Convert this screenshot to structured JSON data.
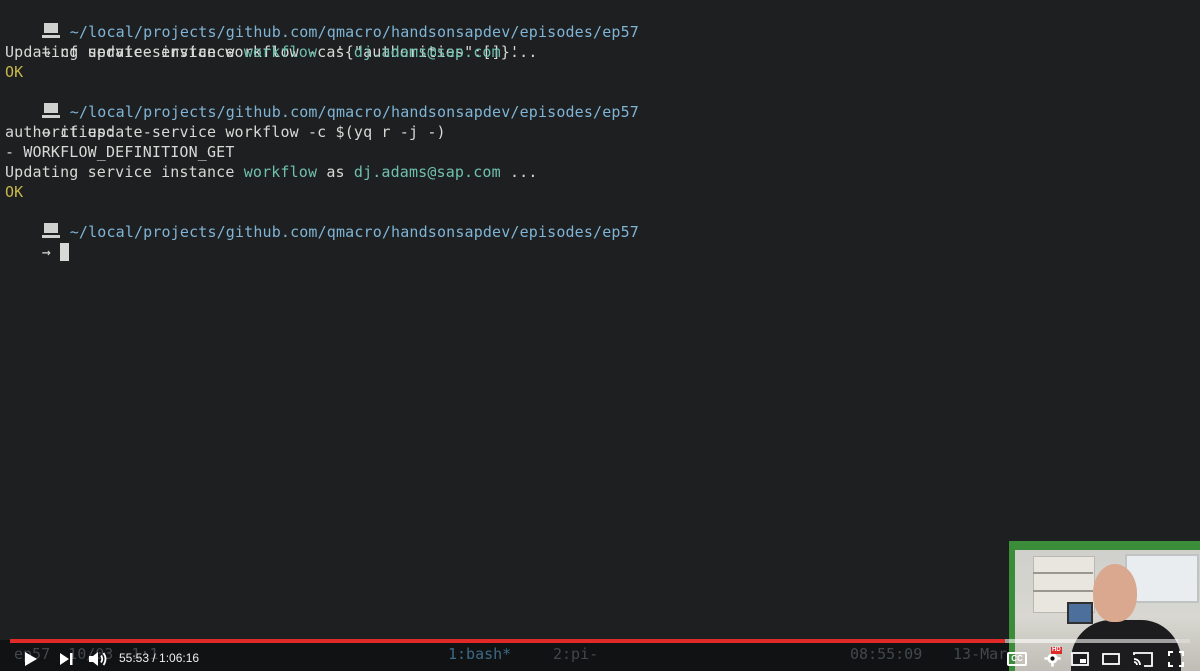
{
  "terminal": {
    "line1": {
      "path": "~/local/projects/github.com/qmacro/handsonsapdev/episodes/ep57"
    },
    "line2": {
      "arrow": "→",
      "command": "cf update-service workflow -c '{\"authorities\":[]}'"
    },
    "line3": {
      "pre": "Updating service instance ",
      "service": "workflow",
      "mid": " as ",
      "user": "dj.adams@sap.com",
      "post": " ..."
    },
    "line4": {
      "status": "OK"
    },
    "line5": {
      "path": "~/local/projects/github.com/qmacro/handsonsapdev/episodes/ep57"
    },
    "line6": {
      "arrow": "→",
      "command": "cf update-service workflow -c $(yq r -j -)"
    },
    "line7": {
      "text": "authorities:"
    },
    "line8": {
      "text": "- WORKFLOW_DEFINITION_GET"
    },
    "line9": {
      "pre": "Updating service instance ",
      "service": "workflow",
      "mid": " as ",
      "user": "dj.adams@sap.com",
      "post": " ..."
    },
    "line10": {
      "status": "OK"
    },
    "line11": {
      "path": "~/local/projects/github.com/qmacro/handsonsapdev/episodes/ep57"
    },
    "line12": {
      "arrow": "→"
    }
  },
  "tmux": {
    "left": "ep57  10/03  1:1",
    "window1": "1:bash*",
    "window2": "2:pi-",
    "time": "08:55:09",
    "date": "13-Mar"
  },
  "player": {
    "current_time": "55:53",
    "separator": " / ",
    "duration": "1:06:16",
    "progress_fraction": 0.843,
    "buffered_fraction": 0.99,
    "cc_label": "CC",
    "hd_label": "HD",
    "accent_color": "#e02a2a",
    "icons": [
      "play-icon",
      "next-icon",
      "volume-icon",
      "captions-icon",
      "settings-icon",
      "miniplayer-icon",
      "theater-mode-icon",
      "cast-icon",
      "fullscreen-icon"
    ]
  },
  "colors": {
    "background": "#1e1f20",
    "path": "#7fb4d6",
    "highlight": "#6fc0b0",
    "ok": "#c8b84a",
    "webcam_border": "#3c8d3a"
  }
}
